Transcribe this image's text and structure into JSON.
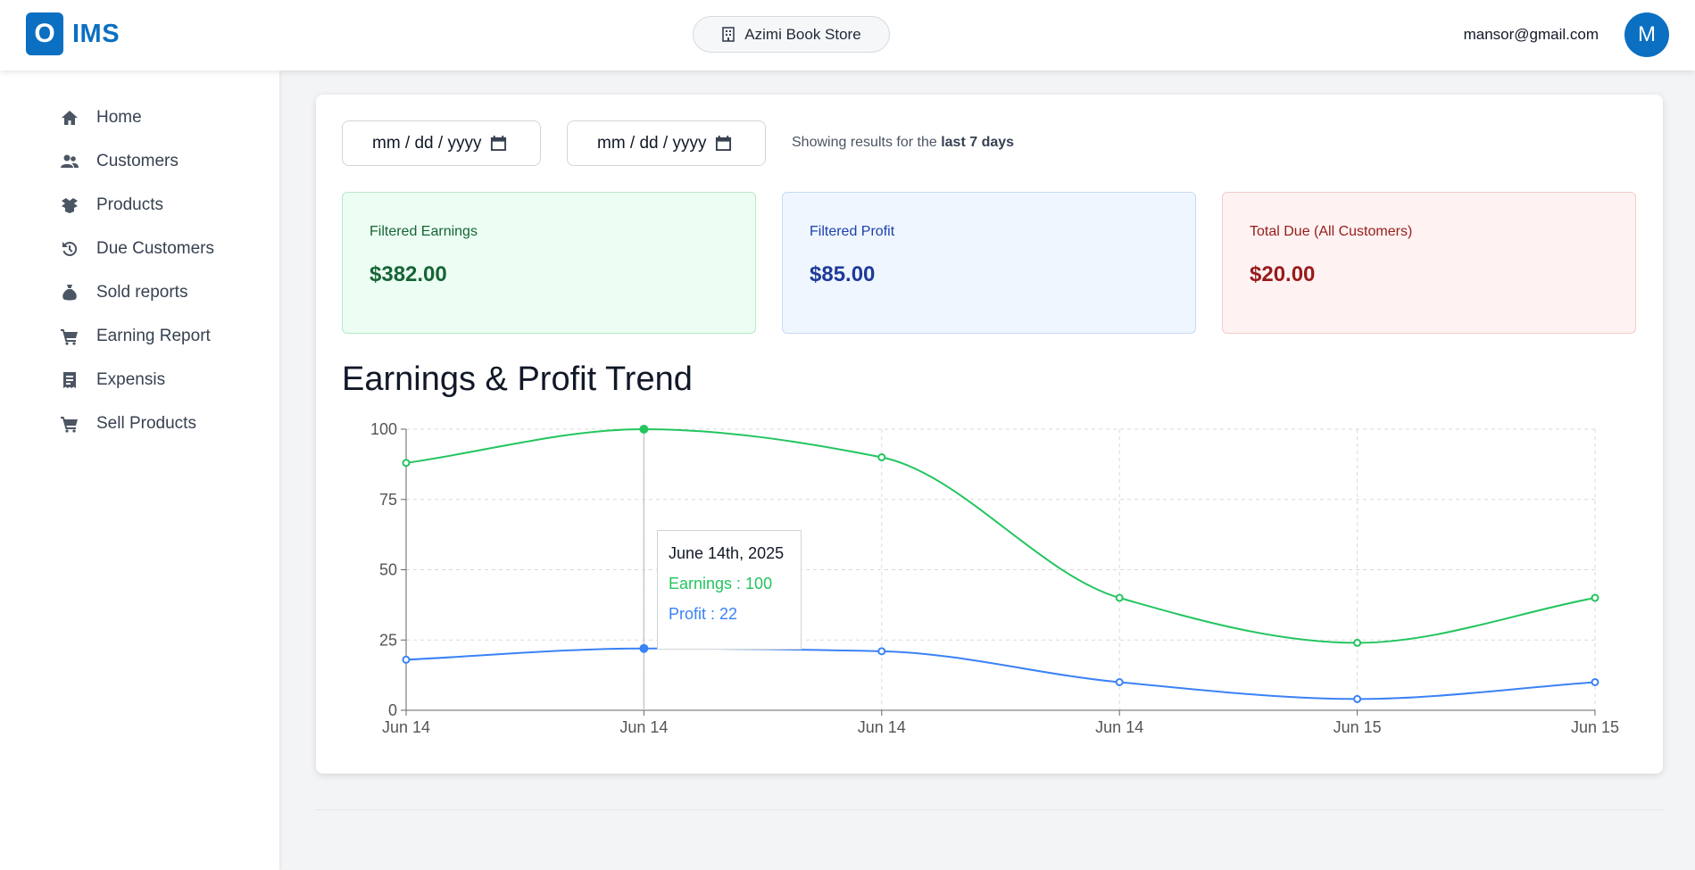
{
  "header": {
    "logo_letter": "O",
    "logo_text": "IMS",
    "store_name": "Azimi Book Store",
    "user_email": "mansor@gmail.com",
    "avatar_initial": "M"
  },
  "sidebar": {
    "items": [
      {
        "label": "Home",
        "icon": "home-icon"
      },
      {
        "label": "Customers",
        "icon": "users-icon"
      },
      {
        "label": "Products",
        "icon": "box-icon"
      },
      {
        "label": "Due Customers",
        "icon": "history-icon"
      },
      {
        "label": "Sold reports",
        "icon": "money-bag-icon"
      },
      {
        "label": "Earning Report",
        "icon": "cart-icon"
      },
      {
        "label": "Expensis",
        "icon": "receipt-icon"
      },
      {
        "label": "Sell Products",
        "icon": "cart-icon"
      }
    ]
  },
  "filters": {
    "start_date_placeholder": "mm / dd / yyyy",
    "end_date_placeholder": "mm / dd / yyyy",
    "showing_prefix": "Showing results for the",
    "showing_range": "last 7 days"
  },
  "stats": [
    {
      "label": "Filtered Earnings",
      "value": "$382.00",
      "bg": "#ecfdf3",
      "border": "#bbe7cb",
      "label_color": "#166534",
      "value_color": "#166534"
    },
    {
      "label": "Filtered Profit",
      "value": "$85.00",
      "bg": "#eff6ff",
      "border": "#c7dbf5",
      "label_color": "#1e40af",
      "value_color": "#1e3a9a"
    },
    {
      "label": "Total Due (All Customers)",
      "value": "$20.00",
      "bg": "#fef2f2",
      "border": "#f3cccc",
      "label_color": "#991b1b",
      "value_color": "#991b1b"
    }
  ],
  "chart": {
    "title": "Earnings & Profit Trend",
    "tooltip": {
      "date": "June 14th, 2025",
      "earnings_label": "Earnings : 100",
      "profit_label": "Profit : 22"
    }
  },
  "chart_data": {
    "type": "line",
    "x": [
      "Jun 14",
      "Jun 14",
      "Jun 14",
      "Jun 14",
      "Jun 15",
      "Jun 15"
    ],
    "series": [
      {
        "name": "Earnings",
        "values": [
          88,
          100,
          90,
          40,
          24,
          40
        ],
        "color": "#22c55e"
      },
      {
        "name": "Profit",
        "values": [
          18,
          22,
          21,
          10,
          4,
          10
        ],
        "color": "#3b82f6"
      }
    ],
    "yticks": [
      0,
      25,
      50,
      75,
      100
    ],
    "ylim": [
      0,
      100
    ],
    "grid": true,
    "active_index": 1
  }
}
